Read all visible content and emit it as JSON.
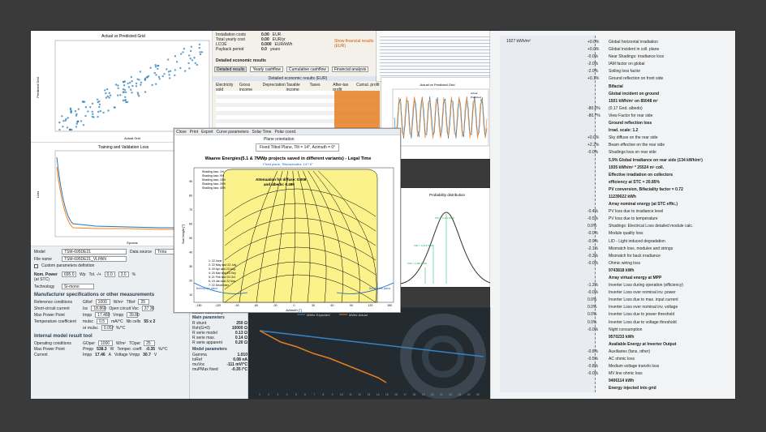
{
  "scatter": {
    "title": "Actual vs Predicted Grid",
    "xlabel": "Actual Grid",
    "ylabel": "Predicted Grid"
  },
  "loss": {
    "title": "Training and Validation Loss",
    "xlabel": "Epochs",
    "ylabel": "Loss"
  },
  "econ": {
    "rows": [
      [
        "Installation costs",
        "0.00",
        "EUR"
      ],
      [
        "Total yearly cost",
        "0.00",
        "EUR/yr"
      ],
      [
        "LCOE",
        "0.000",
        "EUR/kWh"
      ],
      [
        "Payback period",
        "0.0",
        "years"
      ]
    ],
    "link": "Show financial results (EUR)",
    "tabs": [
      "Detailed results",
      "Yearly cashflow",
      "Cumulative cashflow",
      "Financial analysis"
    ],
    "section": "Detailed economic results",
    "table_title": "Detailed economic results (EUR)",
    "cols": [
      "Electricity sold",
      "Gross income",
      "Depreciation",
      "Taxable income",
      "Taxes",
      "After-tax profit",
      "Cumul. profit"
    ]
  },
  "code": {
    "title": "Actual vs Predicted Grid"
  },
  "ts": {
    "legend": [
      "Actual",
      "Predicted"
    ]
  },
  "prob": {
    "title": "Probability distribution",
    "labels": [
      "P50 = 3,412 MWh",
      "P90 = 3,223 MWh",
      "P99 = 3,080 MWh"
    ]
  },
  "loss_diagram": {
    "top_value": "1927 kWh/m²",
    "items": [
      {
        "pct": "+0.0%",
        "label": "Global horizontal irradiation"
      },
      {
        "pct": "+0.0%",
        "label": "Global incident in coll. plane"
      },
      {
        "pct": "-0.0%",
        "label": "Near Shadings: irradiance loss"
      },
      {
        "pct": "-2.0%",
        "label": "IAM factor on global"
      },
      {
        "pct": "-2.0%",
        "label": "Soiling loss factor"
      },
      {
        "pct": "+0.1%",
        "label": "Ground reflection on front side"
      },
      {
        "pct": "",
        "label": "Bifacial"
      },
      {
        "pct": "",
        "label": "Global incident on ground"
      },
      {
        "pct": "",
        "label": "1501 kWh/m² on 85048 m²"
      },
      {
        "pct": "-80.0%",
        "label": "(0.17 Gnd. albedo)"
      },
      {
        "pct": "-80.7%",
        "label": "View Factor for rear side"
      },
      {
        "pct": "",
        "label": "Ground reflection loss"
      },
      {
        "pct": "",
        "label": "Irrad. scale: 1.2"
      },
      {
        "pct": "+0.0%",
        "label": "Sky diffuse on the rear side"
      },
      {
        "pct": "+2.2%",
        "label": "Beam effective on the rear side"
      },
      {
        "pct": "-0.0%",
        "label": "Shadings loss on rear side"
      },
      {
        "pct": "",
        "label": "5.9% Global Irradiance on rear side (134 kWh/m²)"
      },
      {
        "pct": "",
        "label": "1935 kWh/m² * 25524 m² coll."
      },
      {
        "pct": "",
        "label": "Effective irradiation on collectors"
      },
      {
        "pct": "",
        "label": "efficiency at STC = 20.85%"
      },
      {
        "pct": "",
        "label": "PV conversion, Bifaciality factor = 0.72"
      },
      {
        "pct": "",
        "label": "11239022 kWh"
      },
      {
        "pct": "",
        "label": "Array nominal energy (at STC effic.)"
      },
      {
        "pct": "-0.4%",
        "label": "PV loss due to irradiance level"
      },
      {
        "pct": "-0.5%",
        "label": "PV loss due to temperature"
      },
      {
        "pct": "0.0%",
        "label": "Shadings: Electrical Loss detailed module calc."
      },
      {
        "pct": "-0.0%",
        "label": "Module quality loss"
      },
      {
        "pct": "-0.9%",
        "label": "LID - Light induced degradation"
      },
      {
        "pct": "-2.1%",
        "label": "Mismatch loss, modules and strings"
      },
      {
        "pct": "-0.3%",
        "label": "Mismatch for back irradiance"
      },
      {
        "pct": "-0.0%",
        "label": "Ohmic wiring loss"
      },
      {
        "pct": "",
        "label": "9743818 kWh"
      },
      {
        "pct": "",
        "label": "Array virtual energy at MPP"
      },
      {
        "pct": "-1.2%",
        "label": "Inverter Loss during operation (efficiency)"
      },
      {
        "pct": "-0.0%",
        "label": "Inverter Loss over nominal inv. power"
      },
      {
        "pct": "0.0%",
        "label": "Inverter Loss due to max. input current"
      },
      {
        "pct": "0.0%",
        "label": "Inverter Loss over nominal inv. voltage"
      },
      {
        "pct": "0.0%",
        "label": "Inverter Loss due to power threshold"
      },
      {
        "pct": "0.0%",
        "label": "Inverter Loss due to voltage threshold"
      },
      {
        "pct": "-0.0%",
        "label": "Night consumption"
      },
      {
        "pct": "",
        "label": "9570233 kWh"
      },
      {
        "pct": "",
        "label": "Available Energy at Inverter Output"
      },
      {
        "pct": "-0.8%",
        "label": "Auxiliaries (fans, other)"
      },
      {
        "pct": "-0.5%",
        "label": "AC ohmic loss"
      },
      {
        "pct": "-0.8%",
        "label": "Medium voltage transfo loss"
      },
      {
        "pct": "-0.0%",
        "label": "MV line ohmic loss"
      },
      {
        "pct": "",
        "label": "9406114 kWh"
      },
      {
        "pct": "",
        "label": "Energy injected into grid"
      }
    ]
  },
  "shade": {
    "menu": [
      "Close",
      "Print",
      "Export",
      "Curve parameters",
      "Solar Time",
      "Polar coord."
    ],
    "orient_label": "Plane orientation",
    "orient_value": "Fixed Tilted Plane, Tilt = 14°, Azimuth = 0°",
    "title": "Waaree Energies(5.1 & 7MWp projects saved in different variants) - Legal Time",
    "subtitle": "Fixed plane, Tilts/azimuths: 14°/ 0°",
    "atten": "Attenuation for diffuse: 0.008",
    "albedo": "and albedo: 0.489",
    "legend": [
      "Shading loss: 1%",
      "Shading loss: 5%",
      "Shading loss: 10%",
      "Shading loss: 20%",
      "Shading loss: 40%"
    ],
    "dates": [
      "1: 22 June",
      "2: 22 May and 23 July",
      "3: 20 Apr and 23 Aug",
      "4: 20 Mar and 23 Sep",
      "5: 21 Feb and 23 Oct",
      "6: 19 Jan and 22 Nov",
      "7: 22 December"
    ],
    "behind": "Behind the plane",
    "xlabel": "Azimuth [°]",
    "ylabel": "Sun height [°]",
    "xticks": [
      "-150",
      "-120",
      "-90",
      "-60",
      "-30",
      "0",
      "30",
      "60",
      "90",
      "120",
      "150"
    ],
    "yticks": [
      "10",
      "20",
      "30",
      "40",
      "50",
      "60",
      "70",
      "80",
      "90"
    ]
  },
  "module": {
    "model_label": "Model",
    "model_value": "TSM-695DE21",
    "file_label": "File name",
    "file_value": "TSM-695DE21_VLPAN",
    "source_label": "Data source",
    "source_value": "Trina",
    "custom": "Custom parameters definition",
    "power_label": "Nom. Power",
    "power_sub": "(at STC)",
    "power_value": "695.0",
    "power_unit": "Wp",
    "tol_label": "Tol. -/+",
    "tol1": "0.0",
    "tol2": "3.0",
    "pct": "%",
    "tech_label": "Technology",
    "tech_value": "Si-mono",
    "spec_title": "Manufacturer specifications or other measurements",
    "ref_label": "Reference conditions",
    "gref_label": "GRef",
    "gref": "1000",
    "tref_label": "TRef",
    "tref": "25",
    "isc_label": "Short-circuit current",
    "isc_sym": "Isc",
    "isc": "18.860",
    "voc_label": "Open circuit Voc",
    "voc": "37.30",
    "mpp_label": "Max Power Point",
    "impp_sym": "Impp",
    "impp": "17.480",
    "vmpp_label": "Vmpp",
    "vmpp": "39.80",
    "temp_label": "Temperature coefficient",
    "muisc_sym": "mulsc",
    "muisc": "0.5",
    "muisc_unit": "mA/°C",
    "nbcells_label": "Nb cells",
    "nbcells": "55 x 2",
    "or_label": "or mulsc",
    "or_val": "0.057",
    "or_unit": "%/°C",
    "internal_title": "Internal model result tool",
    "op_label": "Operating conditions",
    "gop_label": "GOper",
    "gop": "1000",
    "w_unit": "W/m²",
    "top_label": "TOper",
    "top": "25",
    "maxp_label": "Max Power Point",
    "pmpp_label": "Pmpp",
    "pmpp": "538.3",
    "w": "W",
    "tempcoef_label": "Temper. coeff.",
    "tempcoef": "-0.35",
    "pc": "%/°C",
    "current_label": "Current",
    "imp_label": "Impp",
    "imp": "17.46",
    "a": "A",
    "vv_label": "Voltage Vmpp",
    "vv": "30.7",
    "v": "V"
  },
  "summary": {
    "title": "Model summary",
    "main_title": "Main parameters",
    "rows": [
      [
        "R shunt",
        "250 Ω"
      ],
      [
        "Rsh(G=0)",
        "10000 Ω"
      ],
      [
        "R serie model",
        "0.13 Ω"
      ],
      [
        "R serie max.",
        "0.14 Ω"
      ],
      [
        "R serie apparent",
        "0.20 Ω"
      ]
    ],
    "model_title": "Model parameters",
    "mrows": [
      [
        "Gamma",
        "1.010"
      ],
      [
        "IoRef",
        "0.08 nA"
      ],
      [
        "muVoc",
        "-111 mV/°C"
      ],
      [
        "muPMax fixed",
        "-0.35 /°C"
      ]
    ]
  },
  "line_chart": {
    "legend": [
      "MWhr Expected",
      "MWhr Actual"
    ],
    "xticks": [
      "1",
      "2",
      "3",
      "4",
      "5",
      "6",
      "7",
      "8",
      "9",
      "10",
      "11",
      "12",
      "13",
      "14",
      "15",
      "16",
      "17",
      "18",
      "19",
      "20",
      "21",
      "22",
      "23",
      "24",
      "25"
    ]
  }
}
